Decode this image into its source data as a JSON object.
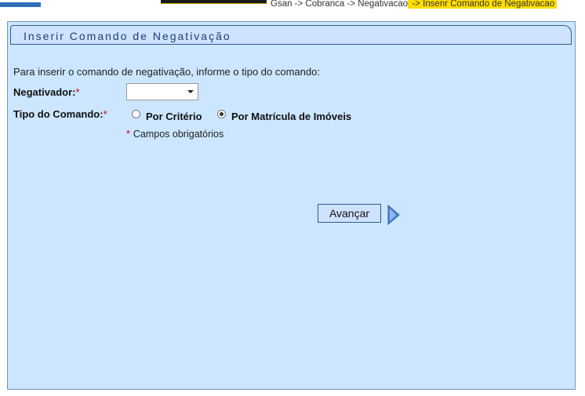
{
  "breadcrumb": {
    "normal": "Gsan -> Cobranca -> Negativacao",
    "highlight": " -> Inserir Comando de Negativacao"
  },
  "panel": {
    "title": "Inserir Comando de Negativação",
    "intro": "Para inserir o comando de negativação, informe o tipo do comando:"
  },
  "form": {
    "negativador_label": "Negativador:",
    "negativador_value": "",
    "tipo_label": "Tipo do Comando:",
    "required_mark": "*",
    "options": [
      {
        "label": "Por Critério",
        "selected": false
      },
      {
        "label": "Por Matrícula de Imóveis",
        "selected": true
      }
    ],
    "footnote": "Campos obrigatórios"
  },
  "actions": {
    "advance_label": "Avançar"
  },
  "colors": {
    "panel_bg": "#cce6ff",
    "highlight": "#ffdd00",
    "required": "#cc0000"
  },
  "icons": {
    "advance": "arrow-right-icon"
  }
}
